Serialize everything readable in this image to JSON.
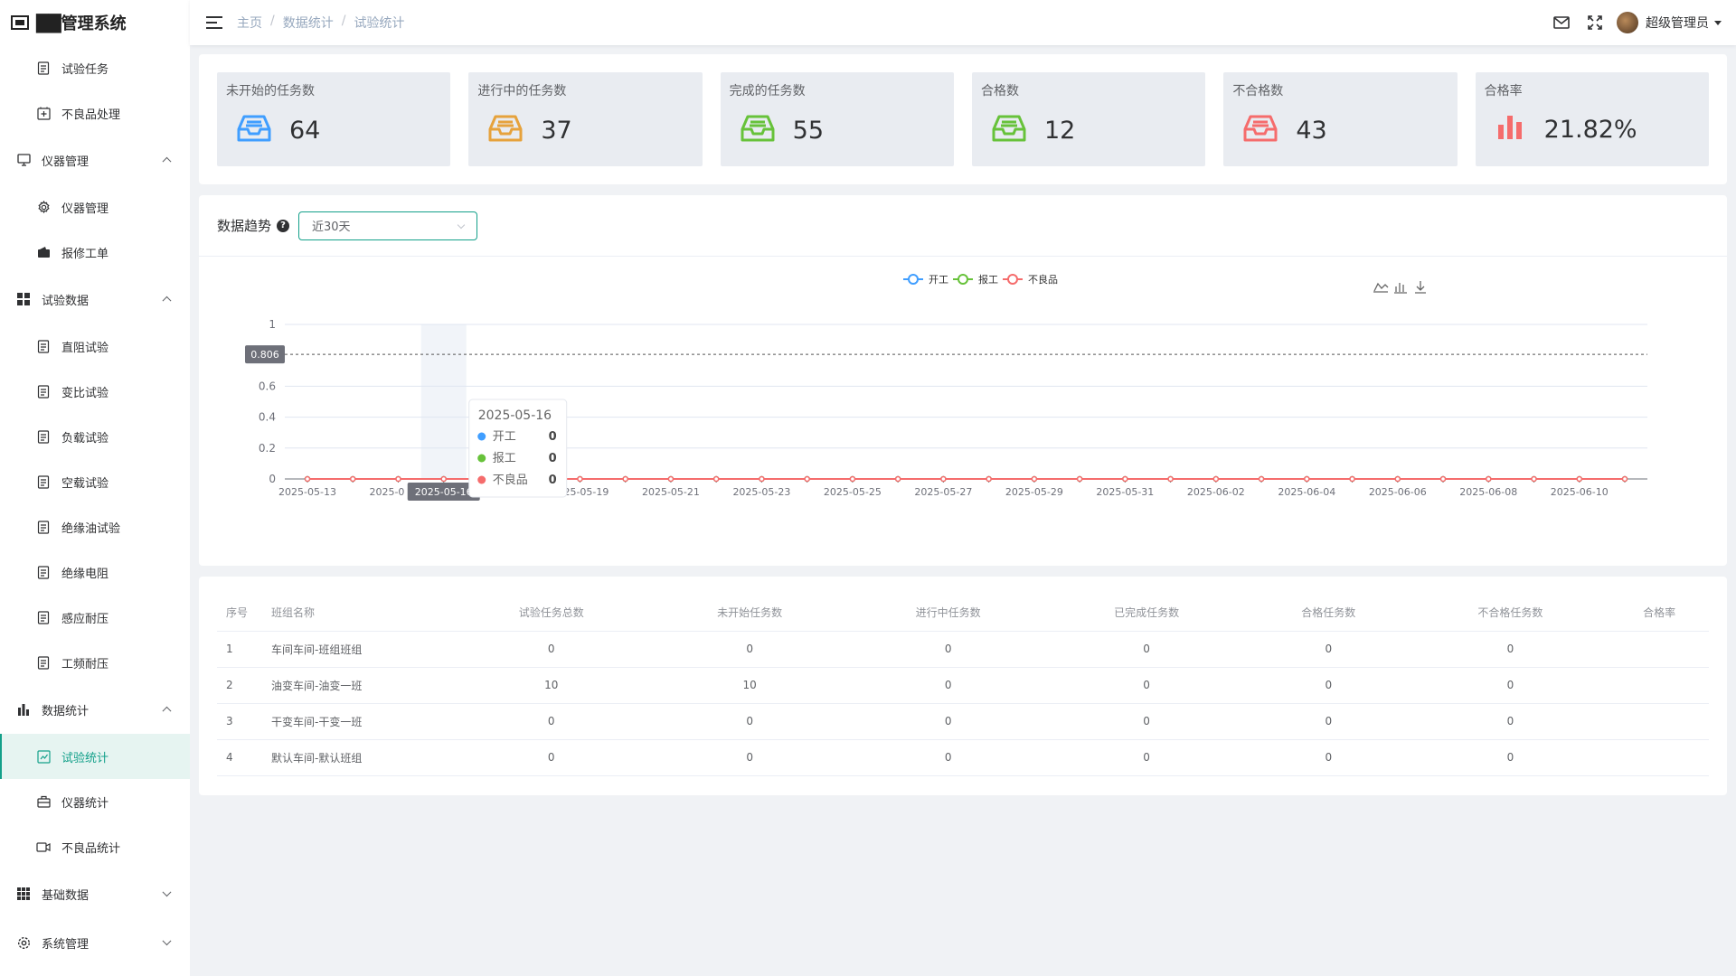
{
  "app": {
    "title": "██管理系统"
  },
  "sidebar": {
    "items": [
      {
        "label": "试验任务",
        "type": "sub"
      },
      {
        "label": "不良品处理",
        "type": "sub"
      },
      {
        "label": "仪器管理",
        "type": "group",
        "expanded": true
      },
      {
        "label": "仪器管理",
        "type": "sub"
      },
      {
        "label": "报修工单",
        "type": "sub"
      },
      {
        "label": "试验数据",
        "type": "group",
        "expanded": true
      },
      {
        "label": "直阻试验",
        "type": "sub"
      },
      {
        "label": "变比试验",
        "type": "sub"
      },
      {
        "label": "负载试验",
        "type": "sub"
      },
      {
        "label": "空载试验",
        "type": "sub"
      },
      {
        "label": "绝缘油试验",
        "type": "sub"
      },
      {
        "label": "绝缘电阻",
        "type": "sub"
      },
      {
        "label": "感应耐压",
        "type": "sub"
      },
      {
        "label": "工频耐压",
        "type": "sub"
      },
      {
        "label": "数据统计",
        "type": "group",
        "expanded": true
      },
      {
        "label": "试验统计",
        "type": "sub",
        "active": true
      },
      {
        "label": "仪器统计",
        "type": "sub"
      },
      {
        "label": "不良品统计",
        "type": "sub"
      },
      {
        "label": "基础数据",
        "type": "group",
        "expanded": false
      },
      {
        "label": "系统管理",
        "type": "group",
        "expanded": false
      }
    ]
  },
  "header": {
    "breadcrumb": [
      "主页",
      "数据统计",
      "试验统计"
    ],
    "user": "超级管理员"
  },
  "stats": [
    {
      "title": "未开始的任务数",
      "value": "64",
      "color": "#409eff"
    },
    {
      "title": "进行中的任务数",
      "value": "37",
      "color": "#e6a23c"
    },
    {
      "title": "完成的任务数",
      "value": "55",
      "color": "#67c23a"
    },
    {
      "title": "合格数",
      "value": "12",
      "color": "#67c23a"
    },
    {
      "title": "不合格数",
      "value": "43",
      "color": "#f56c6c"
    },
    {
      "title": "合格率",
      "value": "21.82%",
      "color": "#f56c6c"
    }
  ],
  "trend": {
    "label": "数据趋势",
    "range": "近30天"
  },
  "chart_data": {
    "type": "line",
    "x": [
      "2025-05-13",
      "2025-05-14",
      "2025-05-15",
      "2025-05-16",
      "2025-05-17",
      "2025-05-18",
      "2025-05-19",
      "2025-05-20",
      "2025-05-21",
      "2025-05-22",
      "2025-05-23",
      "2025-05-24",
      "2025-05-25",
      "2025-05-26",
      "2025-05-27",
      "2025-05-28",
      "2025-05-29",
      "2025-05-30",
      "2025-05-31",
      "2025-06-01",
      "2025-06-02",
      "2025-06-03",
      "2025-06-04",
      "2025-06-05",
      "2025-06-06",
      "2025-06-07",
      "2025-06-08",
      "2025-06-09",
      "2025-06-10",
      "2025-06-11"
    ],
    "series": [
      {
        "name": "开工",
        "color": "#409eff",
        "values": [
          0,
          0,
          0,
          0,
          0,
          0,
          0,
          0,
          0,
          0,
          0,
          0,
          0,
          0,
          0,
          0,
          0,
          0,
          0,
          0,
          0,
          0,
          0,
          0,
          0,
          0,
          0,
          0,
          0,
          0
        ]
      },
      {
        "name": "报工",
        "color": "#67c23a",
        "values": [
          0,
          0,
          0,
          0,
          0,
          0,
          0,
          0,
          0,
          0,
          0,
          0,
          0,
          0,
          0,
          0,
          0,
          0,
          0,
          0,
          0,
          0,
          0,
          0,
          0,
          0,
          0,
          0,
          0,
          0
        ]
      },
      {
        "name": "不良品",
        "color": "#f56c6c",
        "values": [
          0,
          0,
          0,
          0,
          0,
          0,
          0,
          0,
          0,
          0,
          0,
          0,
          0,
          0,
          0,
          0,
          0,
          0,
          0,
          0,
          0,
          0,
          0,
          0,
          0,
          0,
          0,
          0,
          0,
          0
        ]
      }
    ],
    "ylim": [
      0,
      1
    ],
    "yticks": [
      "0",
      "0.2",
      "0.4",
      "0.6",
      "1"
    ],
    "xtick_labels": [
      "2025-05-13",
      "2025-0",
      "2025-05-16",
      "5-05-17",
      "2025-05-19",
      "2025-05-21",
      "2025-05-23",
      "2025-05-25",
      "2025-05-27",
      "2025-05-29",
      "2025-05-31",
      "2025-06-02",
      "2025-06-04",
      "2025-06-06",
      "2025-06-08",
      "2025-06-10"
    ],
    "crosshair": {
      "y_label": "0.806",
      "y_value": 0.806,
      "x_label": "2025-05-16",
      "x_index": 3
    },
    "tooltip": {
      "title": "2025-05-16",
      "rows": [
        {
          "name": "开工",
          "value": "0"
        },
        {
          "name": "报工",
          "value": "0"
        },
        {
          "name": "不良品",
          "value": "0"
        }
      ]
    },
    "legend": "top-center",
    "grid": true
  },
  "table": {
    "headers": [
      "序号",
      "班组名称",
      "试验任务总数",
      "未开始任务数",
      "进行中任务数",
      "已完成任务数",
      "合格任务数",
      "不合格任务数",
      "合格率"
    ],
    "rows": [
      [
        "1",
        "车间车间-班组班组",
        "0",
        "0",
        "0",
        "0",
        "0",
        "0",
        ""
      ],
      [
        "2",
        "油变车间-油变一班",
        "10",
        "10",
        "0",
        "0",
        "0",
        "0",
        ""
      ],
      [
        "3",
        "干变车间-干变一班",
        "0",
        "0",
        "0",
        "0",
        "0",
        "0",
        ""
      ],
      [
        "4",
        "默认车间-默认班组",
        "0",
        "0",
        "0",
        "0",
        "0",
        "0",
        ""
      ]
    ]
  }
}
